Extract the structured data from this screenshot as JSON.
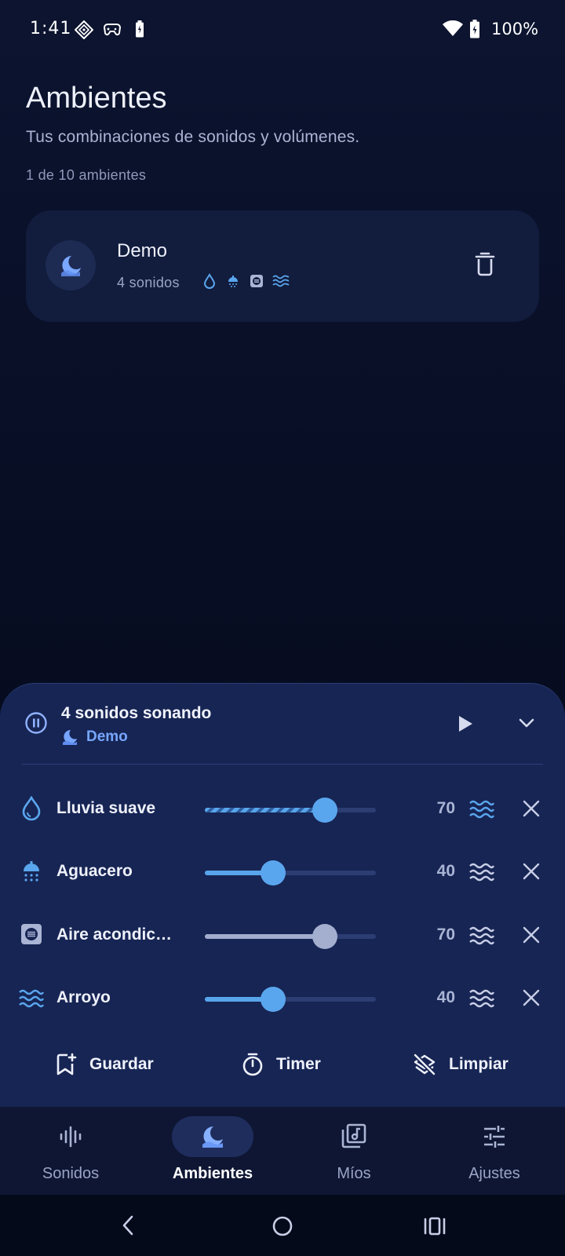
{
  "status_bar": {
    "time": "1:41",
    "battery": "100%"
  },
  "header": {
    "title": "Ambientes",
    "subtitle": "Tus combinaciones de sonidos y volúmenes.",
    "count": "1 de 10 ambientes"
  },
  "presets": [
    {
      "name": "Demo",
      "sound_count": "4 sonidos",
      "icons": [
        "droplet-icon",
        "shower-icon",
        "ac-unit-icon",
        "waves-icon"
      ]
    }
  ],
  "player": {
    "title": "4 sonidos sonando",
    "preset_name": "Demo",
    "sounds": [
      {
        "label": "Lluvia suave",
        "value": "70",
        "level": 0.7,
        "style": "striped",
        "icon": "droplet-icon"
      },
      {
        "label": "Aguacero",
        "value": "40",
        "level": 0.4,
        "style": "solid",
        "icon": "shower-icon"
      },
      {
        "label": "Aire acondic…",
        "value": "70",
        "level": 0.7,
        "style": "grey",
        "icon": "ac-unit-icon"
      },
      {
        "label": "Arroyo",
        "value": "40",
        "level": 0.4,
        "style": "solid",
        "icon": "waves-icon"
      }
    ],
    "actions": {
      "save": "Guardar",
      "timer": "Timer",
      "clear": "Limpiar"
    }
  },
  "nav": {
    "items": [
      {
        "label": "Sonidos",
        "icon": "soundwave-icon"
      },
      {
        "label": "Ambientes",
        "icon": "moon-icon",
        "active": true
      },
      {
        "label": "Míos",
        "icon": "music-library-icon"
      },
      {
        "label": "Ajustes",
        "icon": "sliders-icon"
      }
    ]
  },
  "colors": {
    "accent": "#58a5ec",
    "preset_accent": "#77a6ff",
    "sheet_bg": "#172554",
    "card_bg": "#121c3d"
  }
}
